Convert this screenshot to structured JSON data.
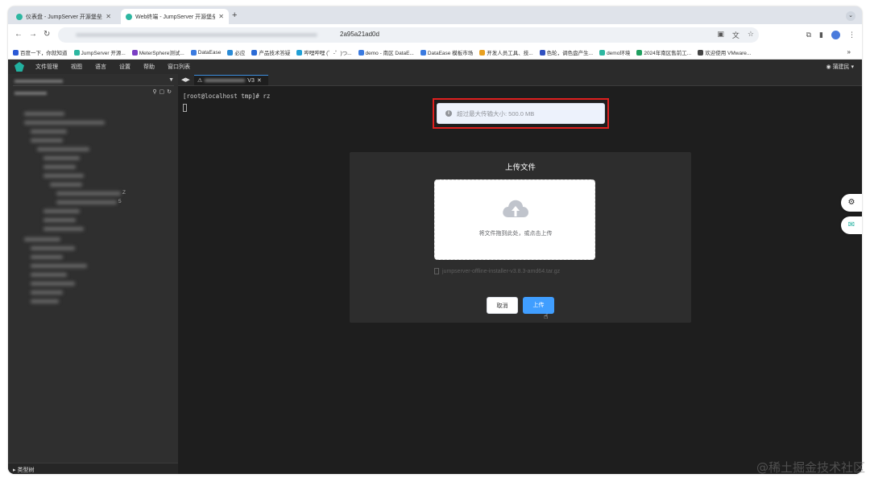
{
  "browser": {
    "tabs": [
      {
        "title": "仪表盘 - JumpServer 开源堡垒机",
        "active": false
      },
      {
        "title": "Web终端 - JumpServer 开源堡垒机",
        "active": true
      }
    ],
    "new_tab": "+",
    "url_suffix": "2a95a21ad0d",
    "bookmarks": [
      {
        "label": "百度一下，你就知道",
        "color": "#2b5ad6"
      },
      {
        "label": "JumpServer 开源...",
        "color": "#2db7a1"
      },
      {
        "label": "MeterSphere测试...",
        "color": "#7b3fc4"
      },
      {
        "label": "DataEase",
        "color": "#3b7be0"
      },
      {
        "label": "必应",
        "color": "#2b8bd6"
      },
      {
        "label": "产品技术答疑",
        "color": "#2b6bd6"
      },
      {
        "label": "哔哩哔哩 (゜-゜)つ...",
        "color": "#21a0d6"
      },
      {
        "label": "demo - 南区 DataE...",
        "color": "#3b7be0"
      },
      {
        "label": "DataEase 模板市场",
        "color": "#3b7be0"
      },
      {
        "label": "开发人员工具、技...",
        "color": "#e8a020"
      },
      {
        "label": "色轮，调色盘产生...",
        "color": "#3050c0"
      },
      {
        "label": "demo环境",
        "color": "#2db7a1"
      },
      {
        "label": "2024年南区售前工...",
        "color": "#20a060"
      },
      {
        "label": "欢迎使用 VMware...",
        "color": "#444444"
      }
    ],
    "bookmarks_more": "»"
  },
  "app": {
    "menu": [
      "文件管理",
      "视图",
      "语言",
      "设置",
      "帮助",
      "窗口列表"
    ],
    "user": "蒲建民",
    "sidebar": {
      "tree_visible": [
        "Z",
        "5"
      ],
      "footer_label": "类型树"
    },
    "terminal": {
      "tab_suffix": "V3",
      "prompt": "[root@localhost tmp]# rz"
    },
    "toast": {
      "message": "超过最大传输大小: 500.0 MB"
    },
    "dialog": {
      "title": "上传文件",
      "drop_text": "将文件拖到此处，或点击上传",
      "file_name": "jumpserver-offline-installer-v3.8.3-amd64.tar.gz",
      "cancel_label": "取消",
      "upload_label": "上传"
    }
  },
  "watermark": "@稀土掘金技术社区",
  "colors": {
    "accent": "#409eff",
    "highlight_border": "#e0201f",
    "brand": "#22b1a0"
  }
}
